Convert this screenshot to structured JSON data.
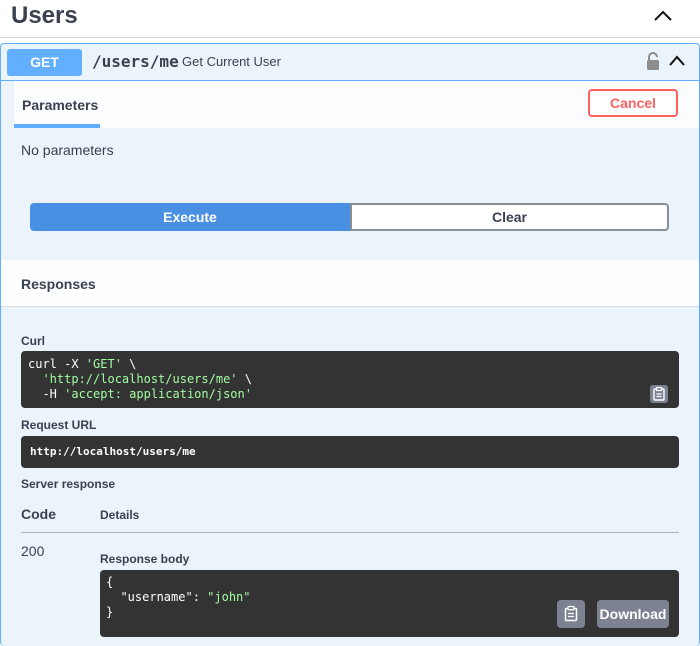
{
  "tag": {
    "title": "Users"
  },
  "operation": {
    "method": "GET",
    "path": "/users/me",
    "description": "Get Current User"
  },
  "parameters": {
    "tab_label": "Parameters",
    "cancel_label": "Cancel",
    "empty_text": "No parameters"
  },
  "actions": {
    "execute_label": "Execute",
    "clear_label": "Clear"
  },
  "responses": {
    "title": "Responses",
    "curl_label": "Curl",
    "curl": {
      "line1_prefix": "curl -X ",
      "line1_method": "'GET'",
      "line1_suffix": " \\",
      "line2_url": "'http://localhost/users/me'",
      "line2_suffix": " \\",
      "line3_flag": "-H ",
      "line3_header": "'accept: application/json'"
    },
    "request_url_label": "Request URL",
    "request_url": "http://localhost/users/me",
    "server_response_label": "Server response",
    "code_header": "Code",
    "details_header": "Details",
    "status_code": "200",
    "response_body_label": "Response body",
    "body": {
      "open": "{",
      "key": "\"username\"",
      "sep": ": ",
      "value": "\"john\"",
      "close": "}"
    },
    "download_label": "Download"
  },
  "colors": {
    "get_accent": "#61affe",
    "execute": "#4990e2",
    "cancel": "#ff6060",
    "code_bg": "#333333",
    "string": "#a2fca2"
  }
}
